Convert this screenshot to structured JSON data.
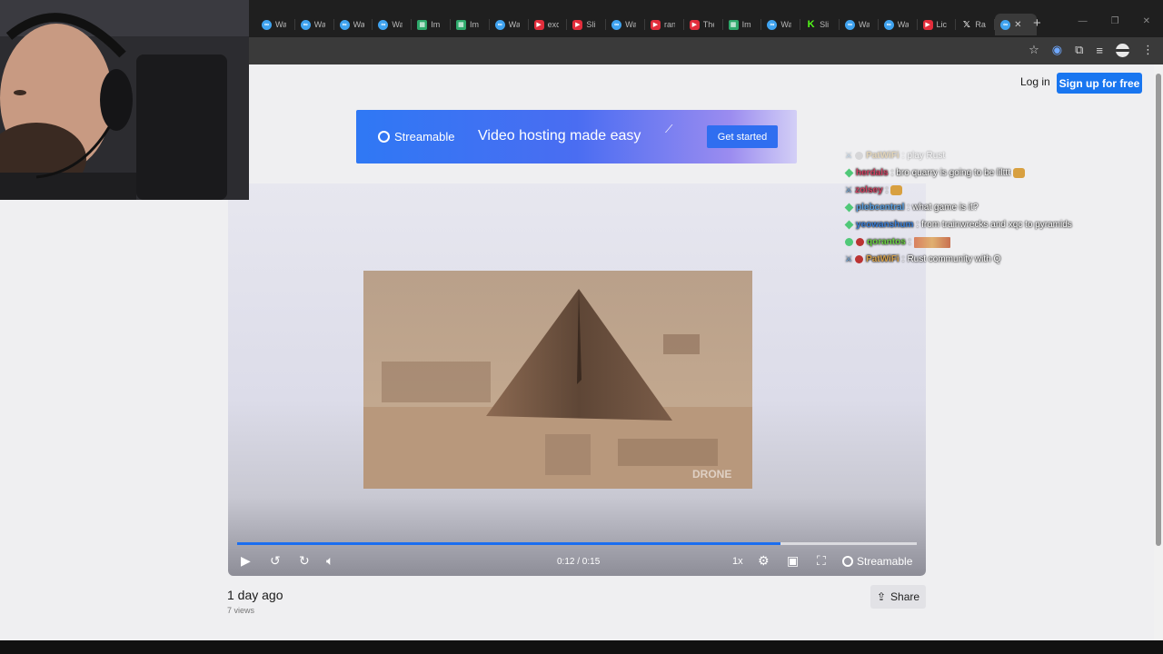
{
  "browser": {
    "tabs": [
      {
        "favicon": "streamable-icon",
        "label": "Wa"
      },
      {
        "favicon": "streamable-icon",
        "label": "Wa"
      },
      {
        "favicon": "streamable-icon",
        "label": "Wa"
      },
      {
        "favicon": "streamable-icon",
        "label": "Wa"
      },
      {
        "favicon": "image-icon",
        "label": "Im"
      },
      {
        "favicon": "image-icon",
        "label": "Im"
      },
      {
        "favicon": "streamable-icon",
        "label": "Wa"
      },
      {
        "favicon": "youtube-icon",
        "label": "exc"
      },
      {
        "favicon": "youtube-icon",
        "label": "Sli"
      },
      {
        "favicon": "streamable-icon",
        "label": "Wa"
      },
      {
        "favicon": "youtube-icon",
        "label": "ran"
      },
      {
        "favicon": "youtube-icon",
        "label": "The"
      },
      {
        "favicon": "image-icon",
        "label": "Im"
      },
      {
        "favicon": "streamable-icon",
        "label": "Wa"
      },
      {
        "favicon": "kick-icon",
        "label": "Sli"
      },
      {
        "favicon": "streamable-icon",
        "label": "Wa"
      },
      {
        "favicon": "streamable-icon",
        "label": "Wa"
      },
      {
        "favicon": "youtube-icon",
        "label": "Lic"
      },
      {
        "favicon": "x-icon",
        "label": "Ra"
      },
      {
        "favicon": "streamable-icon",
        "label": "",
        "active": true
      }
    ]
  },
  "header": {
    "login_label": "Log in",
    "signup_label": "Sign up for free"
  },
  "banner": {
    "logo_text": "Streamable",
    "tagline": "Video hosting made easy",
    "cta_label": "Get started"
  },
  "player": {
    "current_time": "0:12",
    "duration": "0:15",
    "time_display": "0:12 / 0:15",
    "progress": 0.8,
    "speed_label": "1x",
    "brand_label": "Streamable",
    "watermark": "DRONE"
  },
  "meta": {
    "date": "1 day ago",
    "views": "7 views",
    "share_label": "Share"
  },
  "chat": [
    {
      "user": "PatWiFi",
      "color": "#c8a050",
      "text": "play Rust",
      "faded": true,
      "badges": [
        "sword",
        "dot"
      ]
    },
    {
      "user": "herdals",
      "color": "#d04060",
      "text": "bro quarry is going to be lilttt",
      "emote": true,
      "badges": [
        "green"
      ]
    },
    {
      "user": "zolsey",
      "color": "#d04060",
      "text": "",
      "emote": true,
      "badges": [
        "sword"
      ]
    },
    {
      "user": "plebcentral",
      "color": "#5ba0e0",
      "text": "what game is it?",
      "badges": [
        "green"
      ]
    },
    {
      "user": "yeowanshum",
      "color": "#3a7fd8",
      "text": "from trainwrecks and xqc to pyramids",
      "badges": [
        "green"
      ]
    },
    {
      "user": "qorantos",
      "color": "#6ad040",
      "text": "",
      "emote_wide": true,
      "badges": [
        "green-dot",
        "red"
      ]
    },
    {
      "user": "PatWiFi",
      "color": "#d4a04c",
      "text": "Rust community with Q",
      "badges": [
        "sword",
        "red"
      ]
    }
  ],
  "colors": {
    "accent": "#1976f0",
    "page_bg": "#efeff1",
    "chrome_bg": "#1f1f1f"
  }
}
